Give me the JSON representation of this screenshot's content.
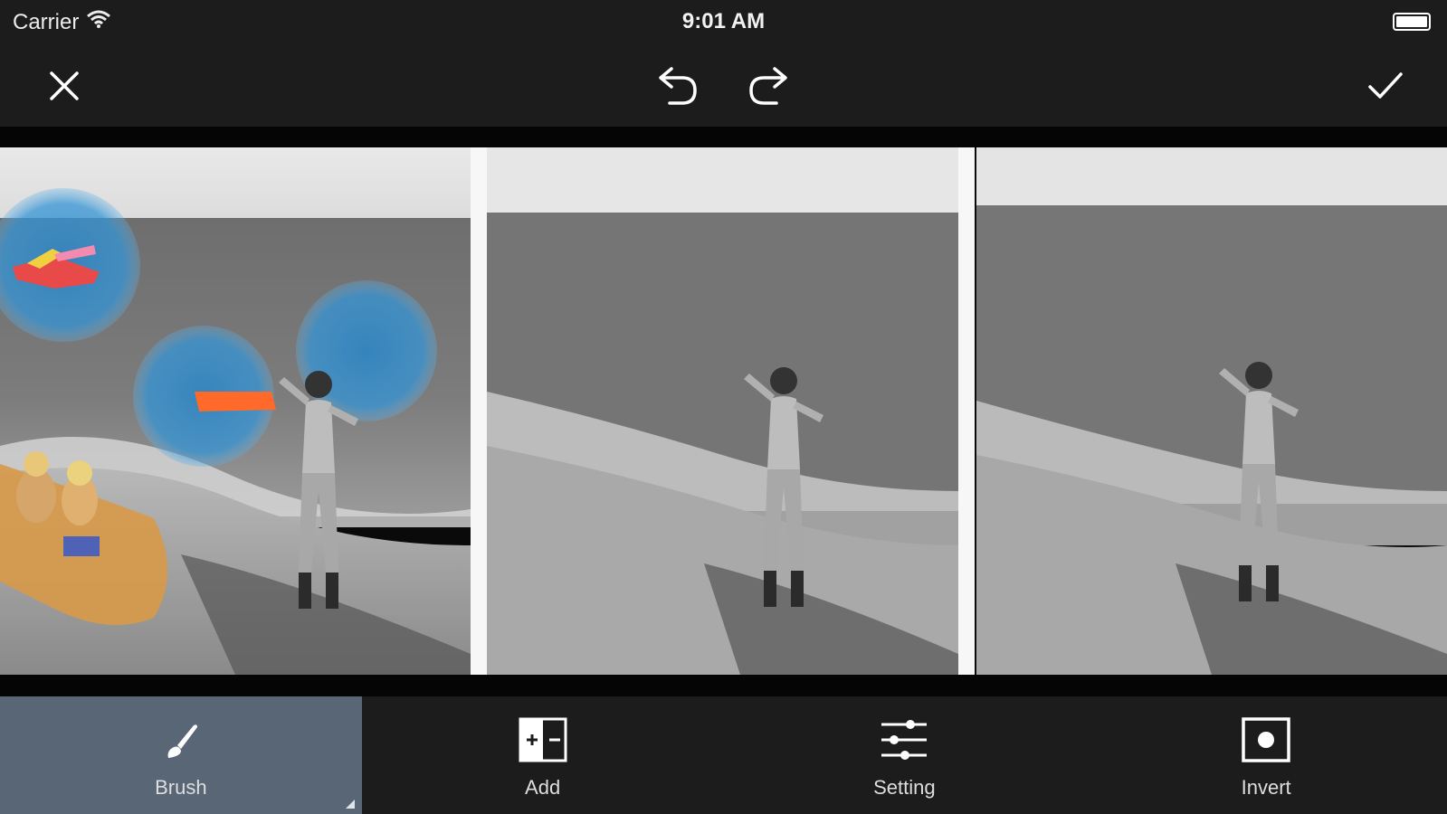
{
  "status_bar": {
    "carrier": "Carrier",
    "time": "9:01 AM",
    "icons": [
      "wifi-icon",
      "battery-icon"
    ]
  },
  "top_toolbar": {
    "icons": [
      "close-icon",
      "undo-icon",
      "redo-icon",
      "checkmark-icon"
    ]
  },
  "photos": {
    "count": 3,
    "highlight_color": "#3f9fe0"
  },
  "tools": [
    {
      "label": "Brush",
      "icon": "brush-icon",
      "active": true
    },
    {
      "label": "Add",
      "icon": "add-compare-icon",
      "active": false
    },
    {
      "label": "Setting",
      "icon": "sliders-icon",
      "active": false
    },
    {
      "label": "Invert",
      "icon": "invert-icon",
      "active": false
    }
  ],
  "colors": {
    "toolbar_bg": "#1c1c1c",
    "active_tool_bg": "#586676",
    "divider": "#f7f7f7"
  }
}
